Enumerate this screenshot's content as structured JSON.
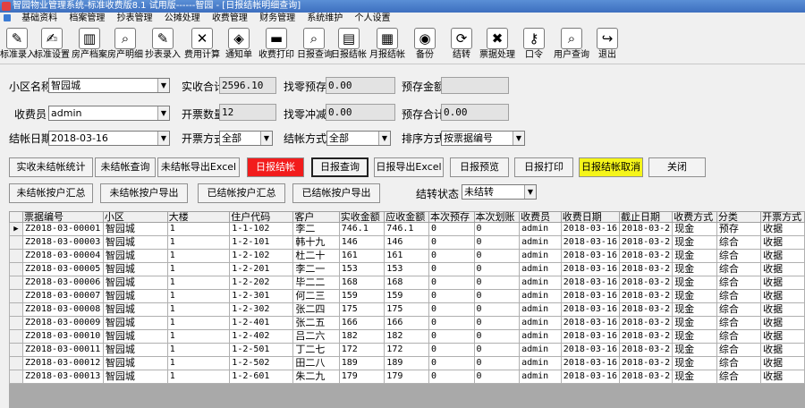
{
  "window": {
    "title": "智园物业管理系统-标准收费版8.1 试用版------智园 - [日报结帐明细查询]"
  },
  "menu": [
    "基础资料",
    "档案管理",
    "抄表管理",
    "公摊处理",
    "收费管理",
    "财务管理",
    "系统维护",
    "个人设置"
  ],
  "toolbar": [
    {
      "label": "标准录入",
      "icon": "edit-icon",
      "glyph": "✎"
    },
    {
      "label": "标准设置",
      "icon": "settings-icon",
      "glyph": "✍"
    },
    {
      "label": "房产档案",
      "icon": "books-icon",
      "glyph": "▥"
    },
    {
      "label": "房产明细",
      "icon": "magnifier-icon",
      "glyph": "⌕"
    },
    {
      "label": "抄表录入",
      "icon": "meter-icon",
      "glyph": "✎"
    },
    {
      "label": "费用计算",
      "icon": "calculator-icon",
      "glyph": "✕"
    },
    {
      "label": "通知单",
      "icon": "notice-icon",
      "glyph": "◈"
    },
    {
      "label": "收费打印",
      "icon": "printer-icon",
      "glyph": "▬"
    },
    {
      "label": "日报查询",
      "icon": "search-icon",
      "glyph": "⌕"
    },
    {
      "label": "日报结帐",
      "icon": "note-icon",
      "glyph": "▤"
    },
    {
      "label": "月报结帐",
      "icon": "document-icon",
      "glyph": "▦"
    },
    {
      "label": "备份",
      "icon": "backup-icon",
      "glyph": "◉"
    },
    {
      "label": "结转",
      "icon": "transfer-icon",
      "glyph": "⟳"
    },
    {
      "label": "票据处理",
      "icon": "cancel-icon",
      "glyph": "✖"
    },
    {
      "label": "口令",
      "icon": "key-icon",
      "glyph": "⚷"
    },
    {
      "label": "用户查询",
      "icon": "user-search-icon",
      "glyph": "⌕"
    },
    {
      "label": "退出",
      "icon": "exit-icon",
      "glyph": "↪"
    }
  ],
  "form": {
    "community_label": "小区名称",
    "community_value": "智园城",
    "actual_total_label": "实收合计",
    "actual_total_value": "2596.10",
    "change_prepay_label": "找零预存",
    "change_prepay_value": "0.00",
    "prepay_amount_label": "预存金额",
    "prepay_amount_value": "",
    "cashier_label": "收费员",
    "cashier_value": "admin",
    "invoice_count_label": "开票数量",
    "invoice_count_value": "12",
    "change_reduce_label": "找零冲减",
    "change_reduce_value": "0.00",
    "prepay_total_label": "预存合计",
    "prepay_total_value": "0.00",
    "close_date_label": "结帐日期",
    "close_date_value": "2018-03-16",
    "invoice_method_label": "开票方式",
    "invoice_method_value": "全部",
    "close_method_label": "结帐方式",
    "close_method_value": "全部",
    "sort_label": "排序方式",
    "sort_value": "按票据编号",
    "carry_status_label": "结转状态",
    "carry_status_value": "未结转"
  },
  "buttons": {
    "row1": [
      "实收未结帐统计",
      "未结帐查询",
      "未结帐导出Excel",
      "日报结帐",
      "日报查询",
      "日报导出Excel",
      "日报预览",
      "日报打印",
      "日报结帐取消",
      "关闭"
    ],
    "row2": [
      "未结帐按户汇总",
      "未结帐按户导出",
      "已结帐按户汇总",
      "已结帐按户导出"
    ]
  },
  "colors": {
    "red_button": "#f21c1c",
    "yellow_button": "#f5f51a"
  },
  "table": {
    "columns": [
      "票据编号",
      "小区",
      "大楼",
      "住户代码",
      "客户",
      "实收金额",
      "应收金额",
      "本次预存",
      "本次划账",
      "收费员",
      "收费日期",
      "截止日期",
      "收费方式",
      "分类",
      "开票方式"
    ],
    "rows": [
      [
        "Z2018-03-00001",
        "智园城",
        "1",
        "1-1-102",
        "李二",
        "746.1",
        "746.1",
        "0",
        "0",
        "admin",
        "2018-03-16",
        "2018-03-2",
        "现金",
        "预存",
        "收据"
      ],
      [
        "Z2018-03-00003",
        "智园城",
        "1",
        "1-2-101",
        "韩十九",
        "146",
        "146",
        "0",
        "0",
        "admin",
        "2018-03-16",
        "2018-03-2",
        "现金",
        "综合",
        "收据"
      ],
      [
        "Z2018-03-00004",
        "智园城",
        "1",
        "1-2-102",
        "杜二十",
        "161",
        "161",
        "0",
        "0",
        "admin",
        "2018-03-16",
        "2018-03-2",
        "现金",
        "综合",
        "收据"
      ],
      [
        "Z2018-03-00005",
        "智园城",
        "1",
        "1-2-201",
        "李二一",
        "153",
        "153",
        "0",
        "0",
        "admin",
        "2018-03-16",
        "2018-03-2",
        "现金",
        "综合",
        "收据"
      ],
      [
        "Z2018-03-00006",
        "智园城",
        "1",
        "1-2-202",
        "毕二二",
        "168",
        "168",
        "0",
        "0",
        "admin",
        "2018-03-16",
        "2018-03-2",
        "现金",
        "综合",
        "收据"
      ],
      [
        "Z2018-03-00007",
        "智园城",
        "1",
        "1-2-301",
        "何二三",
        "159",
        "159",
        "0",
        "0",
        "admin",
        "2018-03-16",
        "2018-03-2",
        "现金",
        "综合",
        "收据"
      ],
      [
        "Z2018-03-00008",
        "智园城",
        "1",
        "1-2-302",
        "张二四",
        "175",
        "175",
        "0",
        "0",
        "admin",
        "2018-03-16",
        "2018-03-2",
        "现金",
        "综合",
        "收据"
      ],
      [
        "Z2018-03-00009",
        "智园城",
        "1",
        "1-2-401",
        "张二五",
        "166",
        "166",
        "0",
        "0",
        "admin",
        "2018-03-16",
        "2018-03-2",
        "现金",
        "综合",
        "收据"
      ],
      [
        "Z2018-03-00010",
        "智园城",
        "1",
        "1-2-402",
        "吕二六",
        "182",
        "182",
        "0",
        "0",
        "admin",
        "2018-03-16",
        "2018-03-2",
        "现金",
        "综合",
        "收据"
      ],
      [
        "Z2018-03-00011",
        "智园城",
        "1",
        "1-2-501",
        "丁二七",
        "172",
        "172",
        "0",
        "0",
        "admin",
        "2018-03-16",
        "2018-03-2",
        "现金",
        "综合",
        "收据"
      ],
      [
        "Z2018-03-00012",
        "智园城",
        "1",
        "1-2-502",
        "田二八",
        "189",
        "189",
        "0",
        "0",
        "admin",
        "2018-03-16",
        "2018-03-2",
        "现金",
        "综合",
        "收据"
      ],
      [
        "Z2018-03-00013",
        "智园城",
        "1",
        "1-2-601",
        "朱二九",
        "179",
        "179",
        "0",
        "0",
        "admin",
        "2018-03-16",
        "2018-03-2",
        "现金",
        "综合",
        "收据"
      ]
    ],
    "current_row_marker": "▶"
  }
}
